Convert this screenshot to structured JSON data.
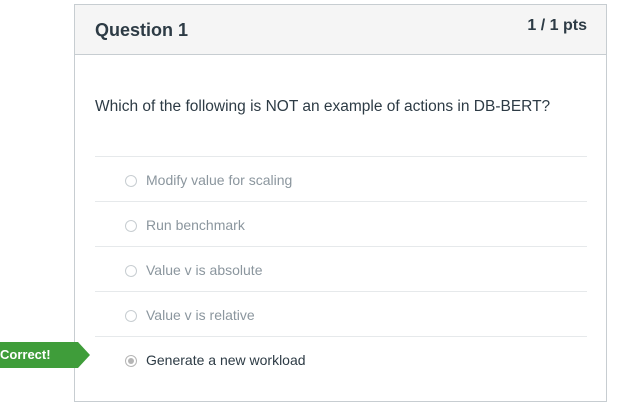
{
  "question": {
    "title": "Question 1",
    "points": "1 / 1 pts",
    "text": "Which of the following is NOT an example of actions in DB-BERT?",
    "answers": [
      {
        "label": "Modify value for scaling",
        "selected": false
      },
      {
        "label": "Run benchmark",
        "selected": false
      },
      {
        "label": "Value v is absolute",
        "selected": false
      },
      {
        "label": "Value v is relative",
        "selected": false
      },
      {
        "label": "Generate a new workload",
        "selected": true
      }
    ]
  },
  "feedback": {
    "label": "Correct!",
    "color": "#3f9d3a"
  }
}
